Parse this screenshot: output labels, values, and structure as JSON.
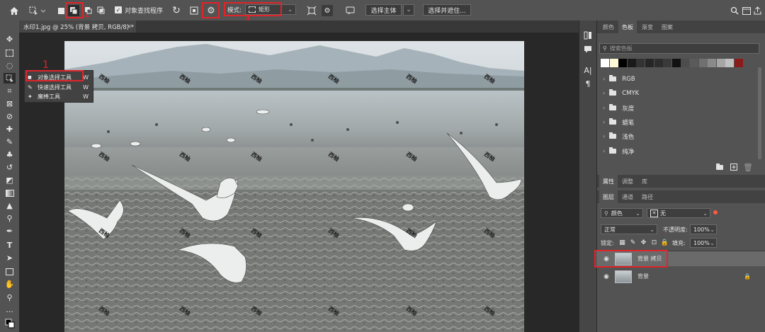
{
  "options_bar": {
    "object_finder_label": "对象查找程序",
    "mode_label": "模式:",
    "mode_value": "矩形",
    "select_subject": "选择主体",
    "select_and_mask": "选择并遮住...",
    "icons": [
      "home-icon",
      "tool-preset-icon",
      "new-selection-icon",
      "add-selection-icon",
      "subtract-selection-icon",
      "intersect-selection-icon",
      "checkbox-icon",
      "refresh-icon",
      "overlay-icon",
      "settings-gear-icon",
      "transform-icon",
      "tool-options-icon",
      "feedback-icon",
      "search-icon",
      "workspace-icon",
      "share-icon"
    ]
  },
  "annotations": {
    "n1": "1",
    "n2": "2",
    "n3": "3",
    "n4": "4"
  },
  "document_tab": {
    "title": "水印1.jpg @ 25% (背景 拷贝, RGB/8) *",
    "close": "×"
  },
  "tool_flyout": {
    "items": [
      {
        "label": "对象选择工具",
        "shortcut": "W"
      },
      {
        "label": "快速选择工具",
        "shortcut": "W"
      },
      {
        "label": "魔棒工具",
        "shortcut": "W"
      }
    ]
  },
  "watermark_text": "西柚",
  "swatches_panel": {
    "tabs": [
      "颜色",
      "色板",
      "渐变",
      "图案"
    ],
    "active_tab": "色板",
    "search_placeholder": "搜索色板",
    "colors": [
      "#ffffff",
      "#fff9d6",
      "#000000",
      "#1a1a1a",
      "#333333",
      "#262626",
      "#2d2d2d",
      "#3a3a3a",
      "#111111",
      "#4d4d4d",
      "#5a5a5a",
      "#707070",
      "#8a8a8a",
      "#a6a6a6",
      "#c0c0c0",
      "#8b1a1a"
    ],
    "folders": [
      "RGB",
      "CMYK",
      "灰度",
      "蜡笔",
      "浅色",
      "纯净"
    ]
  },
  "properties_tabs": {
    "tabs": [
      "属性",
      "调整",
      "库"
    ],
    "active_tab": "属性"
  },
  "layers_panel": {
    "tabs": [
      "图层",
      "通道",
      "路径"
    ],
    "active_tab": "图层",
    "filter_kind": "颜色",
    "filter_value": "无",
    "blend_mode": "正常",
    "opacity_label": "不透明度:",
    "opacity_value": "100%",
    "lock_label": "锁定:",
    "fill_label": "填充:",
    "fill_value": "100%",
    "layers": [
      {
        "name": "背景 拷贝",
        "selected": true
      },
      {
        "name": "背景",
        "selected": false
      }
    ]
  }
}
